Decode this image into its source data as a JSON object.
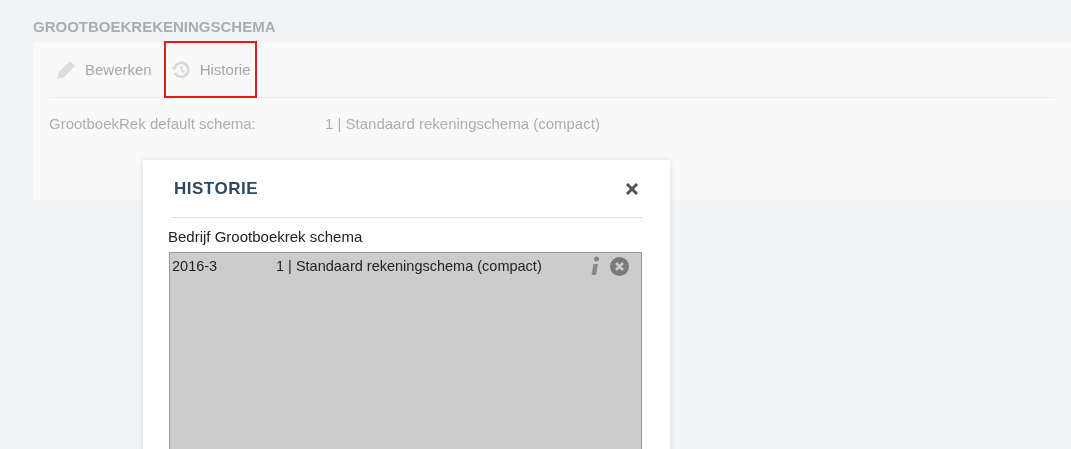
{
  "page_title": "GROOTBOEKREKENINGSCHEMA",
  "toolbar": [
    {
      "kind": "edit",
      "label": "Bewerken",
      "highlighted": false
    },
    {
      "kind": "history",
      "label": "Historie",
      "highlighted": true
    }
  ],
  "field": {
    "label": "GrootboekRek default schema:",
    "value": "1 | Standaard rekeningschema (compact)"
  },
  "dialog": {
    "title": "HISTORIE",
    "section_label": "Bedrijf Grootboekrek schema",
    "rows": [
      {
        "period": "2016-3",
        "value": "1 | Standaard rekeningschema (compact)"
      }
    ]
  }
}
